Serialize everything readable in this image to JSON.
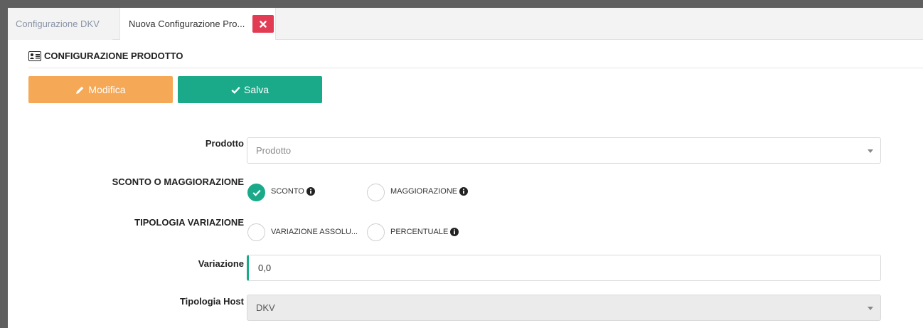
{
  "tabs": [
    {
      "label": "Configurazione DKV"
    },
    {
      "label": "Nuova Configurazione Pro..."
    }
  ],
  "panel": {
    "title": "CONFIGURAZIONE PRODOTTO"
  },
  "toolbar": {
    "edit_label": "Modifica",
    "save_label": "Salva"
  },
  "form": {
    "prodotto": {
      "label": "Prodotto",
      "placeholder": "Prodotto"
    },
    "sconto": {
      "label": "SCONTO O MAGGIORAZIONE",
      "options": [
        {
          "label": "SCONTO",
          "checked": true
        },
        {
          "label": "MAGGIORAZIONE",
          "checked": false
        }
      ]
    },
    "tipologia_variazione": {
      "label": "TIPOLOGIA VARIAZIONE",
      "options": [
        {
          "label": "VARIAZIONE ASSOLU...",
          "checked": false
        },
        {
          "label": "PERCENTUALE",
          "checked": false
        }
      ]
    },
    "variazione": {
      "label": "Variazione",
      "value": "0,0"
    },
    "tipologia_host": {
      "label": "Tipologia Host",
      "value": "DKV"
    }
  },
  "colors": {
    "accent": "#1aaa8a",
    "edit": "#f5a855",
    "close": "#e23c55"
  }
}
